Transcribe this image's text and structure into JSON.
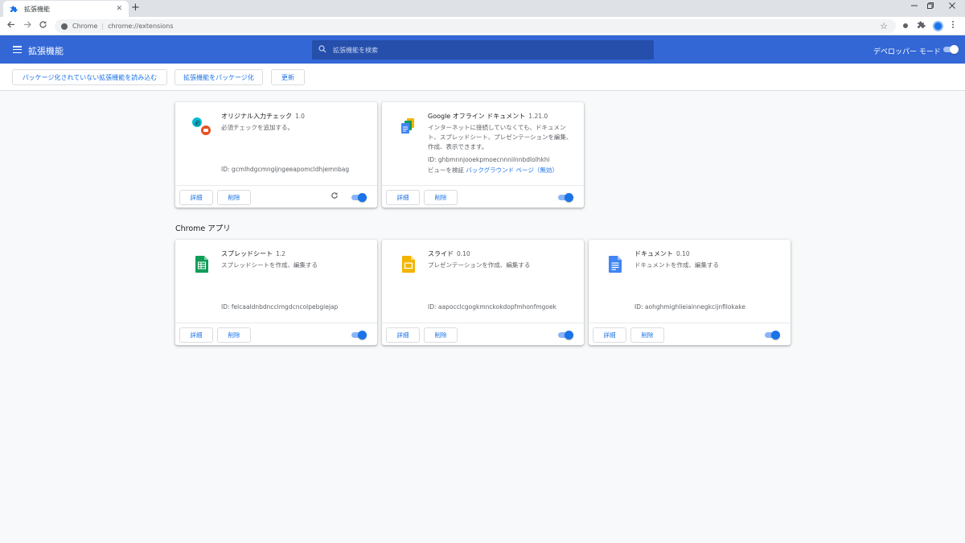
{
  "browser": {
    "tab_title": "拡張機能",
    "close_glyph": "✕",
    "newtab_glyph": "+",
    "url_scheme": "Chrome",
    "url_path": "chrome://extensions"
  },
  "header": {
    "title": "拡張機能",
    "search_placeholder": "拡張機能を検索",
    "devmode_label": "デベロッパー モード",
    "devmode_on": true
  },
  "devbar": {
    "load_unpacked": "パッケージ化されていない拡張機能を読み込む",
    "pack": "拡張機能をパッケージ化",
    "update": "更新"
  },
  "extensions": [
    {
      "name": "オリジナル入力チェック",
      "version": "1.0",
      "description": "必須チェックを追加する。",
      "id": "ID: gcmlhdgcmngijngeeapomcldhjemnbag",
      "details": "詳細",
      "remove": "削除",
      "enabled": true,
      "reload": true,
      "icon": "custom-check-icon"
    },
    {
      "name": "Google オフライン ドキュメント",
      "version": "1.21.0",
      "description": "インターネットに接続していなくても、ドキュメント、スプレッドシート、プレゼンテーションを編集、作成、表示できます。",
      "id": "ID: ghbmnnjooekpmoecnnnilnnbdlolhkhi",
      "inspect_label": "ビューを検証",
      "inspect_link": "バックグラウンド ページ",
      "inspect_suffix": "（無効）",
      "details": "詳細",
      "remove": "削除",
      "enabled": true,
      "icon": "google-docs-offline-icon"
    }
  ],
  "apps_section_title": "Chrome アプリ",
  "apps": [
    {
      "name": "スプレッドシート",
      "version": "1.2",
      "description": "スプレッドシートを作成、編集する",
      "id": "ID: felcaaldnbdncclmgdcncolpebgiejap",
      "details": "詳細",
      "remove": "削除",
      "enabled": true,
      "icon": "sheets-icon",
      "color": "#0f9d58"
    },
    {
      "name": "スライド",
      "version": "0.10",
      "description": "プレゼンテーションを作成、編集する",
      "id": "ID: aapocclcgogkmnckokdopfmhonfmgoek",
      "details": "詳細",
      "remove": "削除",
      "enabled": true,
      "icon": "slides-icon",
      "color": "#f4b400"
    },
    {
      "name": "ドキュメント",
      "version": "0.10",
      "description": "ドキュメントを作成、編集する",
      "id": "ID: aohghmighlieiainnegkcijnfilokake",
      "details": "詳細",
      "remove": "削除",
      "enabled": true,
      "icon": "docs-icon",
      "color": "#4285f4"
    }
  ]
}
